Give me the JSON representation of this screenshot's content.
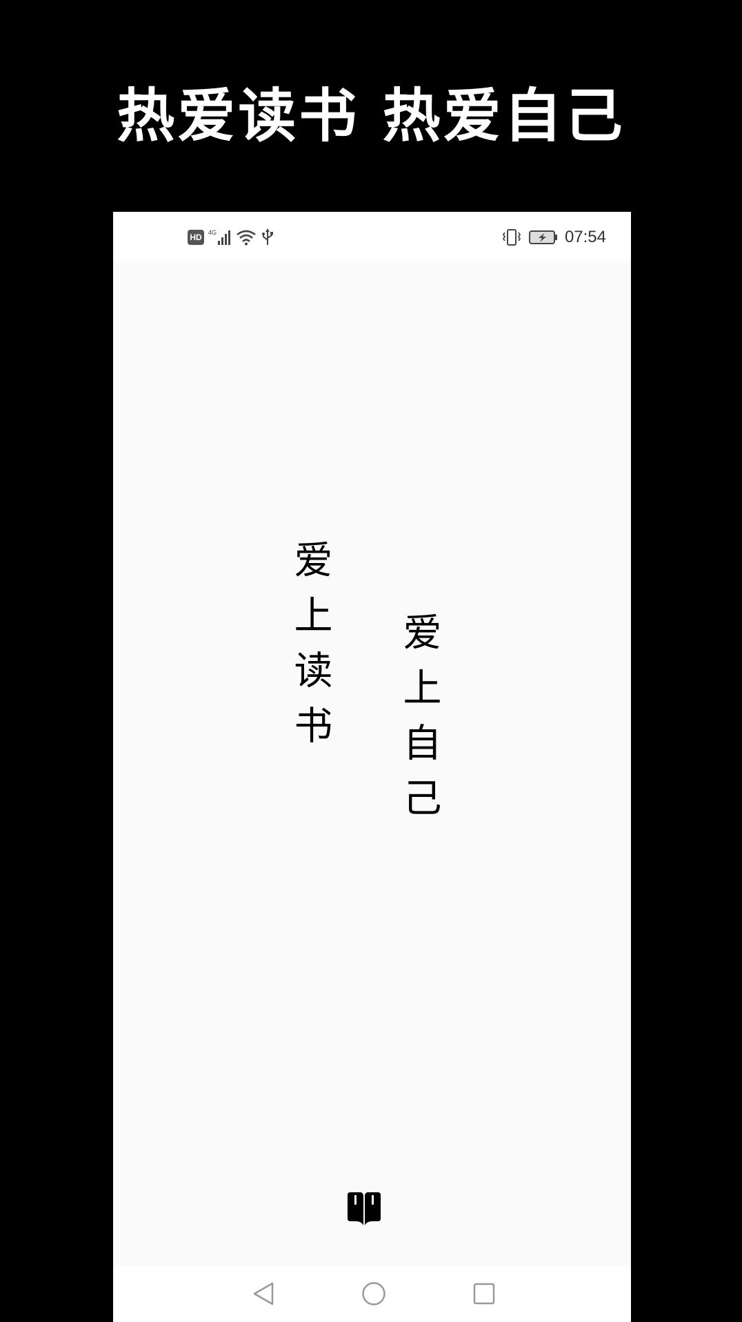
{
  "headline": "热爱读书 热爱自己",
  "status_bar": {
    "hd_label": "HD",
    "network_label": "4G",
    "time": "07:54"
  },
  "splash": {
    "column_left": "爱上读书",
    "column_right": "爱上自己"
  },
  "icons": {
    "app_logo": "open-book-icon",
    "nav": [
      "back-icon",
      "home-icon",
      "recent-apps-icon"
    ]
  },
  "colors": {
    "outer_background": "#000000",
    "screen_background": "#fafafa",
    "text": "#000000"
  }
}
